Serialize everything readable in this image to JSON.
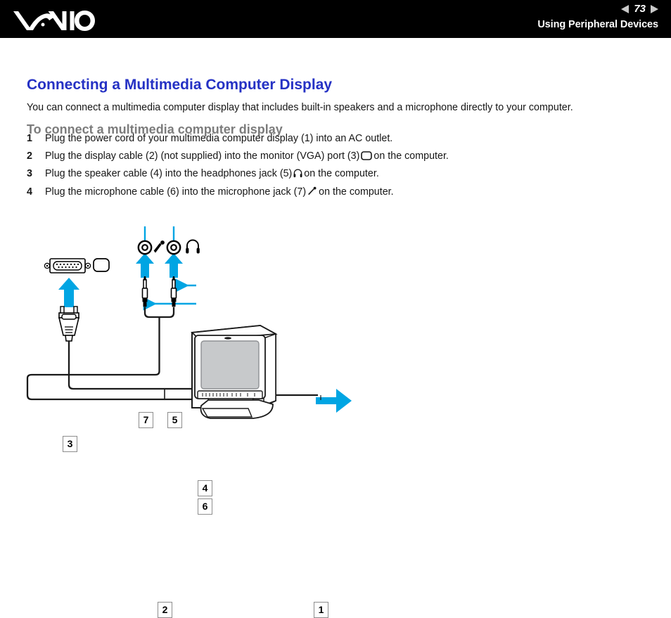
{
  "header": {
    "logo_alt": "VAIO",
    "page_number": "73",
    "prev_icon": "triangle-left-icon",
    "next_icon": "triangle-right-icon",
    "section_title": "Using Peripheral Devices"
  },
  "content": {
    "title": "Connecting a Multimedia Computer Display",
    "intro": "You can connect a multimedia computer display that includes built-in speakers and a microphone directly to your computer.",
    "subheading": "To connect a multimedia computer display",
    "steps": [
      {
        "number": "1",
        "text_before": "Plug the power cord of your multimedia computer display (1) into an AC outlet.",
        "icon": "",
        "text_after": ""
      },
      {
        "number": "2",
        "text_before": "Plug the display cable (2) (not supplied) into the monitor (VGA) port (3)",
        "icon": "vga-monitor-icon",
        "text_after": "on the computer."
      },
      {
        "number": "3",
        "text_before": "Plug the speaker cable (4) into the headphones jack (5)",
        "icon": "headphones-icon",
        "text_after": "on the computer."
      },
      {
        "number": "4",
        "text_before": "Plug the microphone cable (6) into the microphone jack (7)",
        "icon": "microphone-icon",
        "text_after": "on the computer."
      }
    ]
  },
  "diagram": {
    "callouts": [
      {
        "id": "1",
        "label": "1",
        "refers_to": "power-cord"
      },
      {
        "id": "2",
        "label": "2",
        "refers_to": "display-cable"
      },
      {
        "id": "3",
        "label": "3",
        "refers_to": "monitor-vga-port"
      },
      {
        "id": "4",
        "label": "4",
        "refers_to": "speaker-cable-plug"
      },
      {
        "id": "5",
        "label": "5",
        "refers_to": "headphones-jack"
      },
      {
        "id": "6",
        "label": "6",
        "refers_to": "microphone-cable-plug"
      },
      {
        "id": "7",
        "label": "7",
        "refers_to": "microphone-jack"
      }
    ],
    "icons": [
      "vga-port-icon",
      "monitor-icon",
      "microphone-jack-icon",
      "microphone-icon",
      "headphones-jack-icon",
      "headphones-icon",
      "vga-plug-icon",
      "audio-plug-icon",
      "crt-monitor-icon",
      "arrow-up-icon",
      "arrow-right-icon"
    ]
  },
  "colors": {
    "header_background": "#000000",
    "title_blue": "#2531c4",
    "subhead_grey": "#7c7c7c",
    "accent_cyan": "#00a5e3",
    "body_text": "#161616",
    "callout_border": "#8d8d8d",
    "screen_grey": "#c7c9cb"
  }
}
